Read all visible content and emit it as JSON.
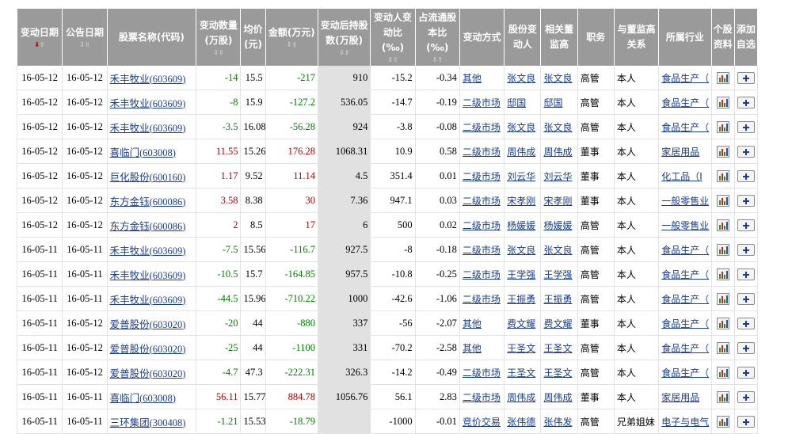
{
  "headers": [
    {
      "label": "变动日期",
      "sort": "active"
    },
    {
      "label": "公告日期",
      "sort": "normal"
    },
    {
      "label": "股票名称(代码)",
      "sort": "none"
    },
    {
      "label": "变动数量(万股)",
      "sort": "normal"
    },
    {
      "label": "均价(元)",
      "sort": "none"
    },
    {
      "label": "金额(万元)",
      "sort": "normal"
    },
    {
      "label": "变动后持股数(万股)",
      "sort": "normal"
    },
    {
      "label": "变动人变动比(‰)",
      "sort": "normal"
    },
    {
      "label": "占流通股本比(‰)",
      "sort": "normal"
    },
    {
      "label": "变动方式",
      "sort": "none"
    },
    {
      "label": "股份变动人",
      "sort": "none"
    },
    {
      "label": "相关董监高",
      "sort": "none"
    },
    {
      "label": "职务",
      "sort": "none"
    },
    {
      "label": "与董监高关系",
      "sort": "none"
    },
    {
      "label": "所属行业",
      "sort": "none"
    },
    {
      "label": "个股资料",
      "sort": "none"
    },
    {
      "label": "添加自选",
      "sort": "none"
    }
  ],
  "sort_glyphs": {
    "active_down": "⬇",
    "up": "⇧",
    "down": "⇩"
  },
  "rows": [
    {
      "change_date": "16-05-12",
      "announce_date": "16-05-12",
      "stock": "禾丰牧业(603609)",
      "qty": "-14",
      "avg_price": "15.5",
      "amount": "-217",
      "holding": "910",
      "ratio_person": "-15.2",
      "ratio_float": "-0.34",
      "method": "其他",
      "changer": "张文良",
      "officer": "张文良",
      "position": "高管",
      "relation": "本人",
      "industry": "食品生产（"
    },
    {
      "change_date": "16-05-12",
      "announce_date": "16-05-12",
      "stock": "禾丰牧业(603609)",
      "qty": "-8",
      "avg_price": "15.9",
      "amount": "-127.2",
      "holding": "536.05",
      "ratio_person": "-14.7",
      "ratio_float": "-0.19",
      "method": "二级市场",
      "changer": "邸国",
      "officer": "邸国",
      "position": "高管",
      "relation": "本人",
      "industry": "食品生产（"
    },
    {
      "change_date": "16-05-12",
      "announce_date": "16-05-12",
      "stock": "禾丰牧业(603609)",
      "qty": "-3.5",
      "avg_price": "16.08",
      "amount": "-56.28",
      "holding": "924",
      "ratio_person": "-3.8",
      "ratio_float": "-0.08",
      "method": "二级市场",
      "changer": "张文良",
      "officer": "张文良",
      "position": "高管",
      "relation": "本人",
      "industry": "食品生产（"
    },
    {
      "change_date": "16-05-12",
      "announce_date": "16-05-12",
      "stock": "喜临门(603008)",
      "qty": "11.55",
      "avg_price": "15.26",
      "amount": "176.28",
      "holding": "1068.31",
      "ratio_person": "10.9",
      "ratio_float": "0.58",
      "method": "二级市场",
      "changer": "周伟成",
      "officer": "周伟成",
      "position": "董事",
      "relation": "本人",
      "industry": "家居用品"
    },
    {
      "change_date": "16-05-12",
      "announce_date": "16-05-12",
      "stock": "巨化股份(600160)",
      "qty": "1.17",
      "avg_price": "9.52",
      "amount": "11.14",
      "holding": "4.5",
      "ratio_person": "351.4",
      "ratio_float": "0.01",
      "method": "二级市场",
      "changer": "刘云华",
      "officer": "刘云华",
      "position": "董事",
      "relation": "本人",
      "industry": "化工品（I"
    },
    {
      "change_date": "16-05-12",
      "announce_date": "16-05-12",
      "stock": "东方金钰(600086)",
      "qty": "3.58",
      "avg_price": "8.38",
      "amount": "30",
      "holding": "7.36",
      "ratio_person": "947.1",
      "ratio_float": "0.03",
      "method": "二级市场",
      "changer": "宋孝刚",
      "officer": "宋孝刚",
      "position": "董事",
      "relation": "本人",
      "industry": "一般零售业"
    },
    {
      "change_date": "16-05-12",
      "announce_date": "16-05-12",
      "stock": "东方金钰(600086)",
      "qty": "2",
      "avg_price": "8.5",
      "amount": "17",
      "holding": "6",
      "ratio_person": "500",
      "ratio_float": "0.02",
      "method": "二级市场",
      "changer": "杨媛媛",
      "officer": "杨媛媛",
      "position": "高管",
      "relation": "本人",
      "industry": "一般零售业"
    },
    {
      "change_date": "16-05-11",
      "announce_date": "16-05-11",
      "stock": "禾丰牧业(603609)",
      "qty": "-7.5",
      "avg_price": "15.56",
      "amount": "-116.7",
      "holding": "927.5",
      "ratio_person": "-8",
      "ratio_float": "-0.18",
      "method": "二级市场",
      "changer": "张文良",
      "officer": "张文良",
      "position": "高管",
      "relation": "本人",
      "industry": "食品生产（"
    },
    {
      "change_date": "16-05-11",
      "announce_date": "16-05-11",
      "stock": "禾丰牧业(603609)",
      "qty": "-10.5",
      "avg_price": "15.7",
      "amount": "-164.85",
      "holding": "957.5",
      "ratio_person": "-10.8",
      "ratio_float": "-0.25",
      "method": "二级市场",
      "changer": "王学强",
      "officer": "王学强",
      "position": "高管",
      "relation": "本人",
      "industry": "食品生产（"
    },
    {
      "change_date": "16-05-11",
      "announce_date": "16-05-11",
      "stock": "禾丰牧业(603609)",
      "qty": "-44.5",
      "avg_price": "15.96",
      "amount": "-710.22",
      "holding": "1000",
      "ratio_person": "-42.6",
      "ratio_float": "-1.06",
      "method": "二级市场",
      "changer": "王振勇",
      "officer": "王振勇",
      "position": "高管",
      "relation": "本人",
      "industry": "食品生产（"
    },
    {
      "change_date": "16-05-11",
      "announce_date": "16-05-12",
      "stock": "爱普股份(603020)",
      "qty": "-20",
      "avg_price": "44",
      "amount": "-880",
      "holding": "337",
      "ratio_person": "-56",
      "ratio_float": "-2.07",
      "method": "其他",
      "changer": "费文耀",
      "officer": "费文耀",
      "position": "董事",
      "relation": "本人",
      "industry": "食品生产（"
    },
    {
      "change_date": "16-05-11",
      "announce_date": "16-05-12",
      "stock": "爱普股份(603020)",
      "qty": "-25",
      "avg_price": "44",
      "amount": "-1100",
      "holding": "331",
      "ratio_person": "-70.2",
      "ratio_float": "-2.58",
      "method": "其他",
      "changer": "王圣文",
      "officer": "王圣文",
      "position": "高管",
      "relation": "本人",
      "industry": "食品生产（"
    },
    {
      "change_date": "16-05-11",
      "announce_date": "16-05-12",
      "stock": "爱普股份(603020)",
      "qty": "-4.7",
      "avg_price": "47.3",
      "amount": "-222.31",
      "holding": "326.3",
      "ratio_person": "-14.2",
      "ratio_float": "-0.49",
      "method": "二级市场",
      "changer": "王圣文",
      "officer": "王圣文",
      "position": "高管",
      "relation": "本人",
      "industry": "食品生产（"
    },
    {
      "change_date": "16-05-11",
      "announce_date": "16-05-11",
      "stock": "喜临门(603008)",
      "qty": "56.11",
      "avg_price": "15.77",
      "amount": "884.78",
      "holding": "1056.76",
      "ratio_person": "56.1",
      "ratio_float": "2.83",
      "method": "二级市场",
      "changer": "周伟成",
      "officer": "周伟成",
      "position": "董事",
      "relation": "本人",
      "industry": "家居用品"
    },
    {
      "change_date": "16-05-11",
      "announce_date": "16-05-11",
      "stock": "三环集团(300408)",
      "qty": "-1.21",
      "avg_price": "15.53",
      "amount": "-18.79",
      "holding": "",
      "ratio_person": "-1000",
      "ratio_float": "-0.01",
      "method": "竞价交易",
      "changer": "张伟德",
      "officer": "张伟发",
      "position": "高管",
      "relation": "兄弟姐妹",
      "industry": "电子与电气"
    }
  ],
  "icons": {
    "detail": "bar-chart-icon",
    "add": "plus-icon"
  },
  "colors": {
    "header_bg": "#9a9a9a",
    "header_text": "#ffffff",
    "negative": "#008000",
    "positive": "#b00000",
    "link": "#1a3d8f",
    "shaded_column": "#e1e1e1"
  }
}
